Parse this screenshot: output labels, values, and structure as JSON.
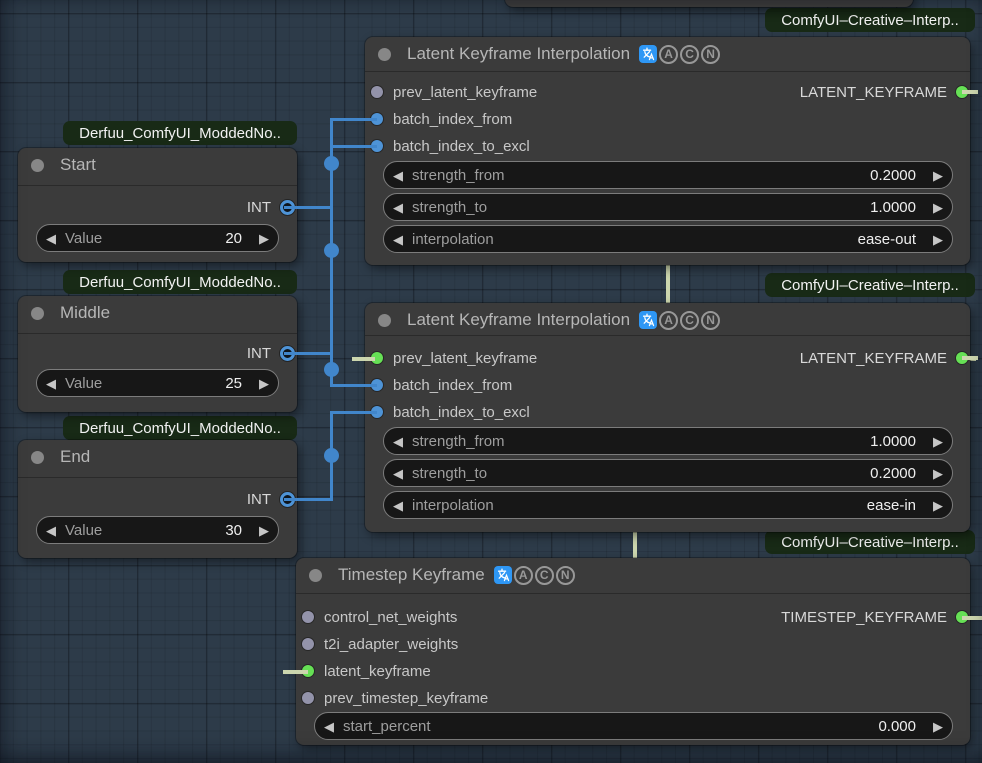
{
  "canvas": {
    "bg_color": "#2d3b49",
    "grid_minor_color": "#26343f",
    "grid_major_color": "#22303d"
  },
  "colors": {
    "node_bg": "#3b3b3b",
    "link_int": "#4186cb",
    "link_keyframe": "#ccd6ae",
    "port_int": "#4e93d6",
    "port_keyframe": "#66e055",
    "port_unconnected": "#9393aa",
    "pack_badge_bg": "#182a16",
    "pack_badge_text": "#f2f2f2",
    "title_icon_bg": "#2e97f5"
  },
  "pack_badges": {
    "derfuu": "Derfuu_ComfyUI_ModdedNo..",
    "creative": "ComfyUI–Creative–Interp.."
  },
  "title_badge_letters": [
    "A",
    "C",
    "N"
  ],
  "nodes": {
    "start": {
      "title": "Start",
      "output_type": "INT",
      "widget": {
        "label": "Value",
        "value": "20"
      }
    },
    "middle": {
      "title": "Middle",
      "output_type": "INT",
      "widget": {
        "label": "Value",
        "value": "25"
      }
    },
    "end": {
      "title": "End",
      "output_type": "INT",
      "widget": {
        "label": "Value",
        "value": "30"
      }
    },
    "lki1": {
      "title": "Latent Keyframe Interpolation",
      "inputs": [
        "prev_latent_keyframe",
        "batch_index_from",
        "batch_index_to_excl"
      ],
      "output_type": "LATENT_KEYFRAME",
      "widgets": [
        {
          "label": "strength_from",
          "value": "0.2000"
        },
        {
          "label": "strength_to",
          "value": "1.0000"
        },
        {
          "label": "interpolation",
          "value": "ease-out"
        }
      ]
    },
    "lki2": {
      "title": "Latent Keyframe Interpolation",
      "inputs": [
        "prev_latent_keyframe",
        "batch_index_from",
        "batch_index_to_excl"
      ],
      "output_type": "LATENT_KEYFRAME",
      "widgets": [
        {
          "label": "strength_from",
          "value": "1.0000"
        },
        {
          "label": "strength_to",
          "value": "0.2000"
        },
        {
          "label": "interpolation",
          "value": "ease-in"
        }
      ]
    },
    "timestep": {
      "title": "Timestep Keyframe",
      "inputs": [
        "control_net_weights",
        "t2i_adapter_weights",
        "latent_keyframe",
        "prev_timestep_keyframe"
      ],
      "output_type": "TIMESTEP_KEYFRAME",
      "widgets": [
        {
          "label": "start_percent",
          "value": "0.000"
        }
      ]
    }
  }
}
